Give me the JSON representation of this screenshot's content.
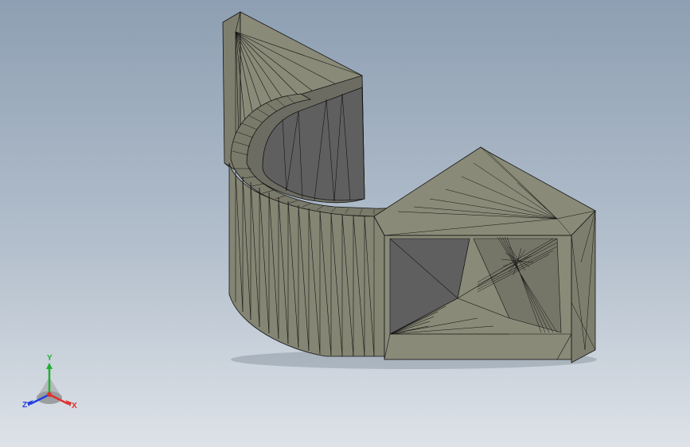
{
  "viewport": {
    "background_top": "#8e9fb3",
    "background_bottom": "#dde2e8"
  },
  "model": {
    "shade_light": "#8a8a78",
    "shade_mid": "#7a7a6a",
    "shade_dark": "#5f5f5f",
    "edge_color": "#141414",
    "display_style": "wireframe-shaded"
  },
  "triad": {
    "x_label": "X",
    "y_label": "Y",
    "z_label": "Z",
    "x_color": "#e03030",
    "y_color": "#20b030",
    "z_color": "#2040e0"
  }
}
